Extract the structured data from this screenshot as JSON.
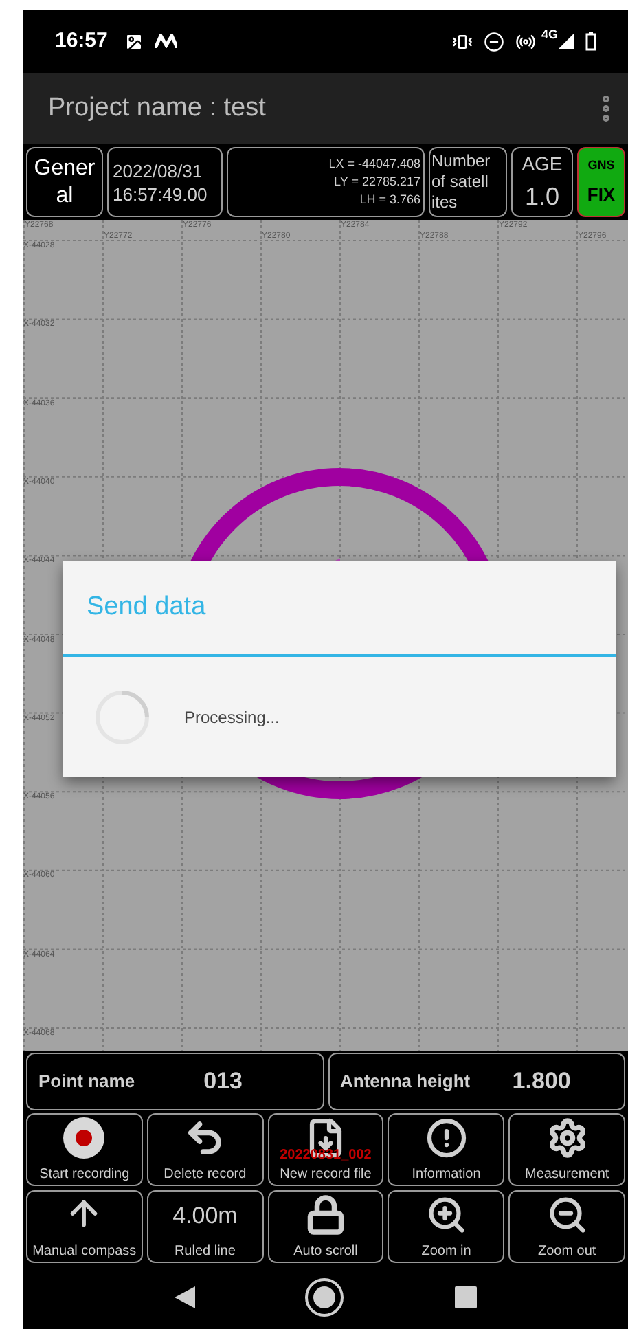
{
  "status_bar": {
    "time": "16:57",
    "network": "4G"
  },
  "app_bar": {
    "title": "Project name : test"
  },
  "info_row": {
    "mode": "Gener al",
    "date": "2022/08/31",
    "time": "16:57:49.00",
    "coords": [
      "LX = -44047.408",
      "LY = 22785.217",
      "LH = 3.766"
    ],
    "satellites_label": "Number of satell ites",
    "age_label": "AGE",
    "age_value": "1.0",
    "gnss_label": "GNS",
    "gnss_value": "FIX",
    "gnss_fixed": true
  },
  "map": {
    "y_labels": [
      "Y22768",
      "Y22772",
      "Y22776",
      "Y22780",
      "Y22784",
      "Y22788",
      "Y22792",
      "Y22796"
    ],
    "x_labels": [
      "X-44028",
      "X-44032",
      "X-44036",
      "X-44040",
      "X-44044",
      "X-44048",
      "X-44052",
      "X-44056",
      "X-44060",
      "X-44064",
      "X-44068"
    ]
  },
  "dialog": {
    "title": "Send data",
    "message": "Processing..."
  },
  "point_row": [
    {
      "label": "Point name",
      "value": "013"
    },
    {
      "label": "Antenna height",
      "value": "1.800"
    }
  ],
  "buttons": [
    {
      "kind": "record",
      "label": "Start recording"
    },
    {
      "kind": "undo",
      "label": "Delete record"
    },
    {
      "kind": "file",
      "label": "New record file",
      "overlay": "20220831_002"
    },
    {
      "kind": "info",
      "label": "Information"
    },
    {
      "kind": "gear",
      "label": "Measurement"
    },
    {
      "kind": "arrow",
      "label": "Manual compass"
    },
    {
      "kind": "value",
      "label": "Ruled line",
      "value": "4.00m"
    },
    {
      "kind": "lock",
      "label": "Auto scroll"
    },
    {
      "kind": "zoom-in",
      "label": "Zoom in"
    },
    {
      "kind": "zoom-out",
      "label": "Zoom out"
    }
  ]
}
